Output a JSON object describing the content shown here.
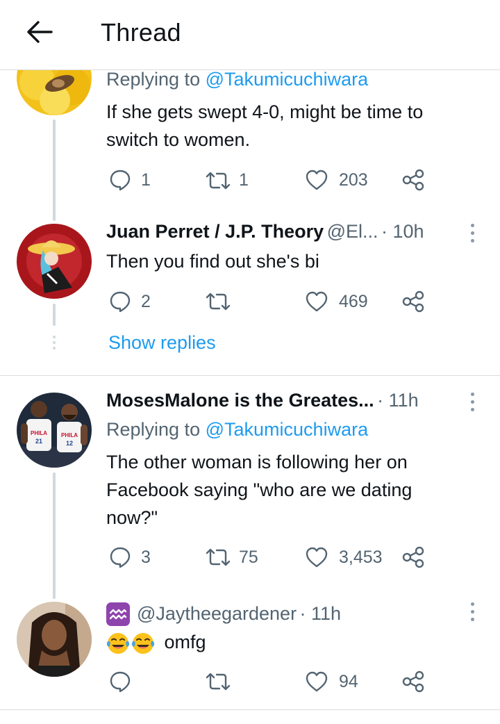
{
  "header": {
    "title": "Thread",
    "back_icon": "arrow-left-icon"
  },
  "tweets": [
    {
      "replying_label": "Replying to",
      "replying_to": "@Takumicuchiwara",
      "text_line1": "If she gets swept 4-0, might be time to",
      "text_line2": "switch to women.",
      "replies": "1",
      "retweets": "1",
      "likes": "203"
    },
    {
      "name": "Juan Perret / J.P. Theory",
      "handle": "@El...",
      "time": "· 10h",
      "text_line1": "Then you find out she's bi",
      "replies": "2",
      "retweets": "",
      "likes": "469",
      "show_replies": "Show replies"
    },
    {
      "name": "MosesMalone is the Greates...",
      "time": "· 11h",
      "replying_label": "Replying to",
      "replying_to": "@Takumicuchiwara",
      "text_line1": "The other woman is following her on",
      "text_line2": "Facebook saying \"who are we dating",
      "text_line3": "now?\"",
      "replies": "3",
      "retweets": "75",
      "likes": "3,453",
      "avatar_jersey_left": "PHILA",
      "avatar_num_left": "21",
      "avatar_jersey_right": "PHILA",
      "avatar_num_right": "12"
    },
    {
      "handle": "@Jaytheegardener",
      "time": "· 11h",
      "text_after_emoji": "omfg",
      "replies": "",
      "retweets": "",
      "likes": "94"
    }
  ],
  "colors": {
    "accent": "#1d9bf0",
    "text": "#0f1419",
    "muted": "#536471",
    "line": "#cfd9de"
  }
}
